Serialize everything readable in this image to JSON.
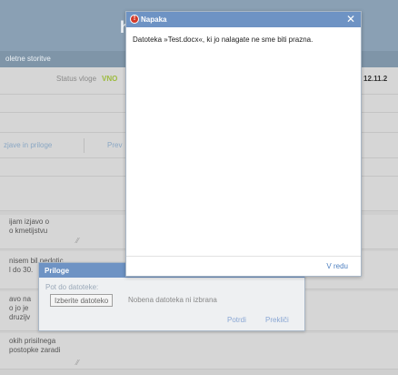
{
  "app": {
    "logo_fragment": "h"
  },
  "nav": {
    "label": "oletne storitve"
  },
  "status": {
    "label": "Status vloge",
    "value": "VNO",
    "date": "12.11.2"
  },
  "tabs": [
    {
      "label": "zjave in priloge"
    },
    {
      "label": "Prev"
    }
  ],
  "declarations": [
    {
      "line1": "ijam izjavo o",
      "line2": "o kmetijstvu"
    },
    {
      "line1": "nisem bil nedotic",
      "line2": "l do 30."
    },
    {
      "line1": "avo na",
      "line2": "o jo je",
      "line3": "druzijv"
    },
    {
      "line1": "okih prisilnega",
      "line2": "postopke zaradi"
    }
  ],
  "error_dialog": {
    "title": "Napaka",
    "icon": "error-icon",
    "message": "Datoteka »Test.docx«, ki jo nalagate ne sme biti prazna.",
    "ok_label": "V redu"
  },
  "attach_dialog": {
    "title": "Priloge",
    "path_label": "Pot do datoteke:",
    "choose_label": "Izberite datoteko",
    "no_file_text": "Nobena datoteka ni izbrana",
    "confirm_label": "Potrdi",
    "cancel_label": "Prekliči"
  }
}
